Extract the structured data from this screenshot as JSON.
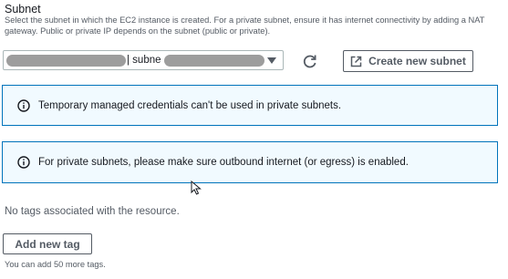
{
  "subnet": {
    "label": "Subnet",
    "description": "Select the subnet in which the EC2 instance is created. For a private subnet, ensure it has internet connectivity by adding a NAT gateway. Public or private IP depends on the subnet (public or private).",
    "selected_value": "| subne",
    "create_button_label": "Create new subnet"
  },
  "alerts": [
    {
      "text": "Temporary managed credentials can't be used in private subnets."
    },
    {
      "text": "For private subnets, please make sure outbound internet (or egress) is enabled."
    }
  ],
  "tags": {
    "empty_text": "No tags associated with the resource.",
    "add_button_label": "Add new tag",
    "hint": "You can add 50 more tags."
  },
  "colors": {
    "alert_border": "#0073bb",
    "alert_background": "#f1faff",
    "text_secondary": "#545b64"
  },
  "icons": [
    "refresh-icon",
    "external-link-icon",
    "info-icon",
    "mouse-cursor-icon"
  ]
}
